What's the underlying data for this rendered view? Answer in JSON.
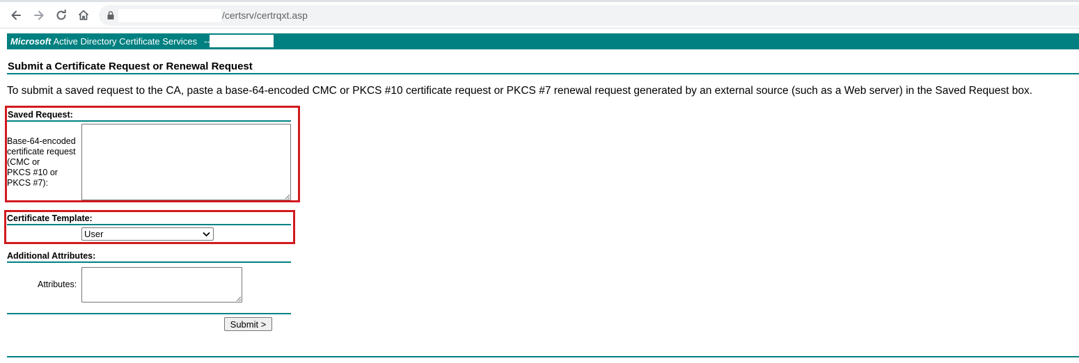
{
  "browser": {
    "url_path": "/certsrv/certrqxt.asp"
  },
  "header": {
    "brand": "Microsoft",
    "title": "Active Directory Certificate Services",
    "separator": "--"
  },
  "page": {
    "heading": "Submit a Certificate Request or Renewal Request",
    "intro": "To submit a saved request to the CA, paste a base-64-encoded CMC or PKCS #10 certificate request or PKCS #7 renewal request generated by an external source (such as a Web server) in the Saved Request box."
  },
  "saved_request": {
    "section_label": "Saved Request:",
    "field_label_lines": [
      "Base-64-encoded",
      "certificate request",
      "(CMC or",
      "PKCS #10 or",
      "PKCS #7):"
    ],
    "value": ""
  },
  "template": {
    "section_label": "Certificate Template:",
    "selected": "User"
  },
  "attributes": {
    "section_label": "Additional Attributes:",
    "field_label": "Attributes:",
    "value": ""
  },
  "actions": {
    "submit_label": "Submit >"
  },
  "colors": {
    "accent": "#008080",
    "highlight": "#d11a1f"
  },
  "icons": [
    "back-arrow-icon",
    "forward-arrow-icon",
    "reload-icon",
    "home-icon",
    "lock-icon",
    "chevron-down-icon",
    "resize-grip-icon"
  ]
}
